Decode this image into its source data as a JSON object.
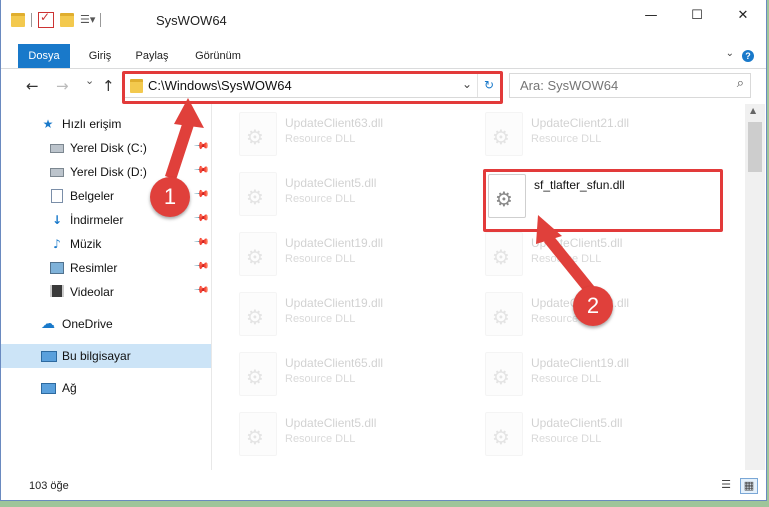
{
  "window": {
    "title": "SysWOW64",
    "caption": {
      "minimize": "—",
      "maximize": "☐",
      "close": "✕"
    }
  },
  "ribbon": {
    "tabs": [
      {
        "label": "Dosya",
        "active": true
      },
      {
        "label": "Giriş",
        "active": false
      },
      {
        "label": "Paylaş",
        "active": false
      },
      {
        "label": "Görünüm",
        "active": false
      }
    ],
    "help": "?"
  },
  "nav": {
    "back": "←",
    "forward": "→",
    "recent": "⌄",
    "up": "↑",
    "address": "C:\\Windows\\SysWOW64",
    "search_placeholder": "Ara: SysWOW64"
  },
  "sidebar": {
    "items": [
      {
        "label": "Hızlı erişim",
        "icon": "star-icon",
        "pinned": false
      },
      {
        "label": "Yerel Disk (C:)",
        "icon": "drive-icon",
        "pinned": true
      },
      {
        "label": "Yerel Disk (D:)",
        "icon": "drive-icon",
        "pinned": true
      },
      {
        "label": "Belgeler",
        "icon": "documents-icon",
        "pinned": true
      },
      {
        "label": "İndirmeler",
        "icon": "download-icon",
        "pinned": true
      },
      {
        "label": "Müzik",
        "icon": "music-icon",
        "pinned": true
      },
      {
        "label": "Resimler",
        "icon": "pictures-icon",
        "pinned": true
      },
      {
        "label": "Videolar",
        "icon": "videos-icon",
        "pinned": true
      },
      {
        "label": "OneDrive",
        "icon": "cloud-icon",
        "pinned": false
      },
      {
        "label": "Bu bilgisayar",
        "icon": "computer-icon",
        "pinned": false,
        "selected": true
      },
      {
        "label": "Ağ",
        "icon": "network-icon",
        "pinned": false
      }
    ]
  },
  "files": [
    {
      "name": "UpdateClient63.dll",
      "type": "Resource DLL",
      "faded": true
    },
    {
      "name": "UpdateClient21.dll",
      "type": "Resource DLL",
      "faded": true
    },
    {
      "name": "UpdateClient5.dll",
      "type": "Resource DLL",
      "faded": true
    },
    {
      "name": "sf_tlafter_sfun.dll",
      "type": "",
      "faded": false
    },
    {
      "name": "UpdateClient19.dll",
      "type": "Resource DLL",
      "faded": true
    },
    {
      "name": "UpdateClient5.dll",
      "type": "Resource DLL",
      "faded": true
    },
    {
      "name": "UpdateClient19.dll",
      "type": "Resource DLL",
      "faded": true
    },
    {
      "name": "UpdateClient42.dll",
      "type": "Resource DLL",
      "faded": true
    },
    {
      "name": "UpdateClient65.dll",
      "type": "Resource DLL",
      "faded": true
    },
    {
      "name": "UpdateClient19.dll",
      "type": "Resource DLL",
      "faded": true
    },
    {
      "name": "UpdateClient5.dll",
      "type": "Resource DLL",
      "faded": true
    },
    {
      "name": "UpdateClient5.dll",
      "type": "Resource DLL",
      "faded": true
    }
  ],
  "status": {
    "count": "103 öğe"
  },
  "annotations": {
    "step1": "1",
    "step2": "2",
    "color": "#e0403b"
  }
}
